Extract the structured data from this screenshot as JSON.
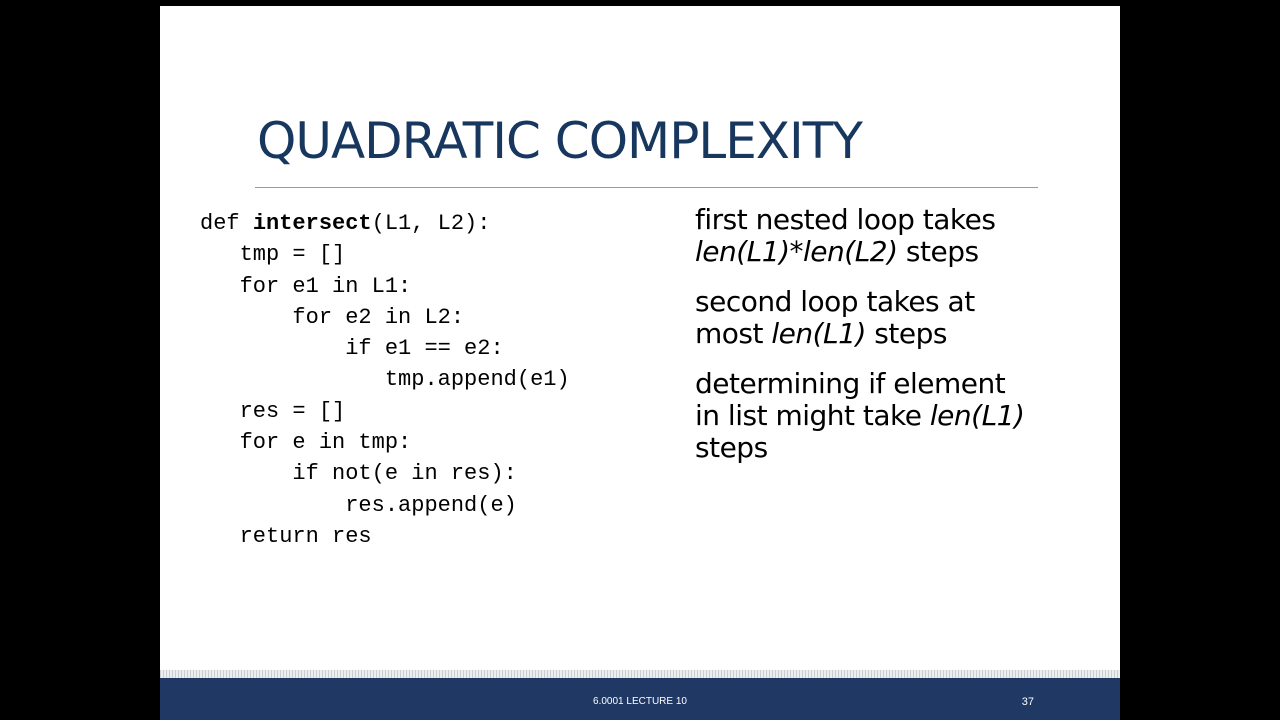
{
  "slide": {
    "title": "QUADRATIC COMPLEXITY",
    "code_lines": [
      {
        "indent": "",
        "prefix": "def ",
        "fn": "intersect",
        "rest": "(L1, L2):"
      },
      {
        "indent": "   ",
        "prefix": "",
        "fn": "",
        "rest": "tmp = []"
      },
      {
        "indent": "   ",
        "prefix": "",
        "fn": "",
        "rest": "for e1 in L1:"
      },
      {
        "indent": "       ",
        "prefix": "",
        "fn": "",
        "rest": "for e2 in L2:"
      },
      {
        "indent": "           ",
        "prefix": "",
        "fn": "",
        "rest": "if e1 == e2:"
      },
      {
        "indent": "              ",
        "prefix": "",
        "fn": "",
        "rest": "tmp.append(e1)"
      },
      {
        "indent": "   ",
        "prefix": "",
        "fn": "",
        "rest": "res = []"
      },
      {
        "indent": "   ",
        "prefix": "",
        "fn": "",
        "rest": "for e in tmp:"
      },
      {
        "indent": "       ",
        "prefix": "",
        "fn": "",
        "rest": "if not(e in res):"
      },
      {
        "indent": "           ",
        "prefix": "",
        "fn": "",
        "rest": "res.append(e)"
      },
      {
        "indent": "   ",
        "prefix": "",
        "fn": "",
        "rest": "return res"
      }
    ],
    "notes": {
      "note1_line1": "first nested loop takes",
      "note1_italic": "len(L1)*len(L2)",
      "note1_tail": " steps",
      "note2_line1": "second loop takes at",
      "note2_prefix": "most ",
      "note2_italic": "len(L1)",
      "note2_tail": " steps",
      "note3_line1": "determining if element",
      "note3_prefix": "in list might take ",
      "note3_italic": "len(L1)",
      "note3_line3": "steps"
    }
  },
  "footer": {
    "label": "6.0001 LECTURE 10",
    "slide_number": "37"
  },
  "colors": {
    "title": "#17375e",
    "footer_bg": "#1f3864",
    "letterbox": "#000000"
  }
}
